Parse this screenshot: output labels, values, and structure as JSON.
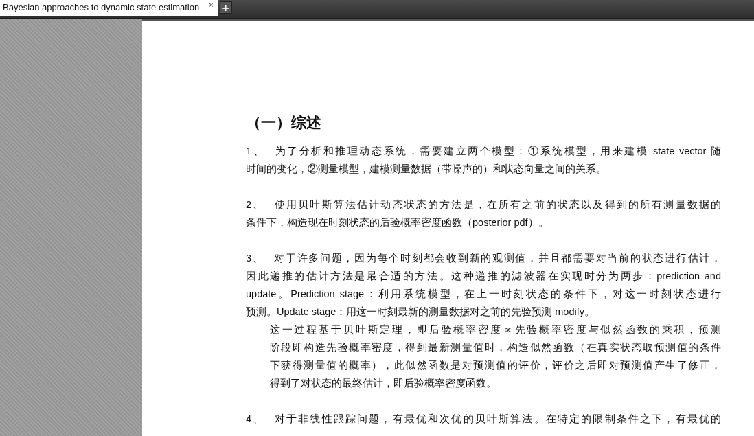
{
  "tabs": [
    {
      "label": "Bayesian approaches to dynamic state estimation",
      "selected": true,
      "close": "×"
    }
  ],
  "new_tab_button": "+",
  "document": {
    "heading": "（一）综述",
    "paragraphs": [
      {
        "kind": "numbered",
        "number": "1、",
        "lines": [
          "为了分析和推理动态系统，需要建立两个模型：①系统模型，用来建模 state vector 随",
          "时间的变化，②测量模型，建模测量数据（带噪声的）和状态向量之间的关系。"
        ]
      },
      {
        "kind": "numbered",
        "number": "2、",
        "lines": [
          "使用贝叶斯算法估计动态状态的方法是，在所有之前的状态以及得到的所有测量数据的",
          "条件下，构造现在时刻状态的后验概率密度函数（posterior pdf）。"
        ]
      },
      {
        "kind": "numbered",
        "number": "3、",
        "lines": [
          "对于许多问题，因为每个时刻都会收到新的观测值，并且都需要对当前的状态进行估计，",
          "因此递推的估计方法是最合适的方法。这种递推的滤波器在实现时分为两步：prediction and",
          "update。Prediction stage：利用系统模型，在上一时刻状态的条件下，对这一时刻状态进行",
          "预测。Update stage：用这一时刻最新的测量数据对之前的先验预测 modify。"
        ]
      },
      {
        "kind": "continuation",
        "lines": [
          "这一过程基于贝叶斯定理，即后验概率密度∝先验概率密度与似然函数的乘积，预测",
          "阶段即构造先验概率密度，得到最新测量值时，构造似然函数（在真实状态取预测值的条件",
          "下获得测量值的概率），此似然函数是对预测值的评价，评价之后即对预测值产生了修正，",
          "得到了对状态的最终估计，即后验概率密度函数。"
        ]
      },
      {
        "kind": "numbered",
        "number": "4、",
        "lines": [
          "对于非线性跟踪问题，有最优和次优的贝叶斯算法。在特定的限制条件之下，有最优的"
        ]
      }
    ]
  }
}
